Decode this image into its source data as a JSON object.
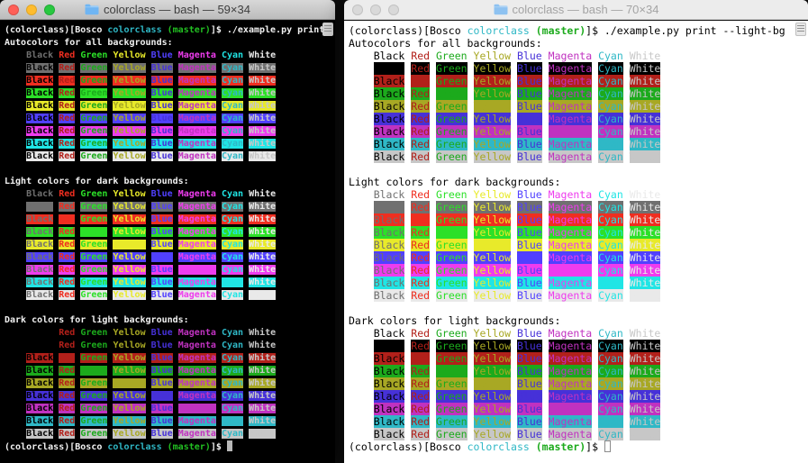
{
  "chrome": {
    "traffic_lights": {
      "red": "#ff5f57",
      "yellow": "#febc2e",
      "green": "#28c840"
    },
    "inactive_light": "#d9d9d9",
    "marker_icon": "scrollbar-marker"
  },
  "palette": {
    "dark": {
      "black": "#000000",
      "red": "#b2201a",
      "green": "#1caa1c",
      "yellow": "#a8a824",
      "blue": "#4631d8",
      "magenta": "#c032c0",
      "cyan": "#2fb8c6",
      "white": "#c7c7c7"
    },
    "light": {
      "black": "#707070",
      "red": "#ef2e20",
      "green": "#2ce028",
      "yellow": "#e8ea2a",
      "blue": "#5140ff",
      "magenta": "#ee3cee",
      "cyan": "#20e5e5",
      "white": "#e9e9e9"
    }
  },
  "color_names": [
    "Black",
    "Red",
    "Green",
    "Yellow",
    "Blue",
    "Magenta",
    "Cyan",
    "White"
  ],
  "color_keys": [
    "black",
    "red",
    "green",
    "yellow",
    "blue",
    "magenta",
    "cyan",
    "white"
  ],
  "sections": [
    {
      "title": "Autocolors for all backgrounds:",
      "header_variant": "auto",
      "fg_variant": "dark",
      "bg_variant": "auto"
    },
    {
      "title": "Light colors for dark backgrounds:",
      "header_variant": "light",
      "fg_variant": "light",
      "bg_variant": "light"
    },
    {
      "title": "Dark colors for light backgrounds:",
      "header_variant": "dark",
      "fg_variant": "dark",
      "bg_variant": "dark"
    }
  ],
  "prompt": {
    "prefix": "(colorclass)[Bosco ",
    "repo": "colorclass",
    "branch": "(master)",
    "suffix": "]$ "
  },
  "terminals": [
    {
      "id": "left",
      "window_title": "colorclass — bash — 59×34",
      "command": "./example.py print",
      "auto_variant": "light",
      "bg": "#000000",
      "fg": "#f2f2f2",
      "repo_color": "#2fb8c6",
      "branch_color": "#22c022",
      "cursor": "solid",
      "active": true
    },
    {
      "id": "right",
      "window_title": "colorclass — bash — 70×34",
      "command": "./example.py print --light-bg",
      "auto_variant": "dark",
      "bg": "#ffffff",
      "fg": "#000000",
      "repo_color": "#2fb8c6",
      "branch_color": "#1caa1c",
      "cursor": "hollow",
      "active": false
    }
  ]
}
